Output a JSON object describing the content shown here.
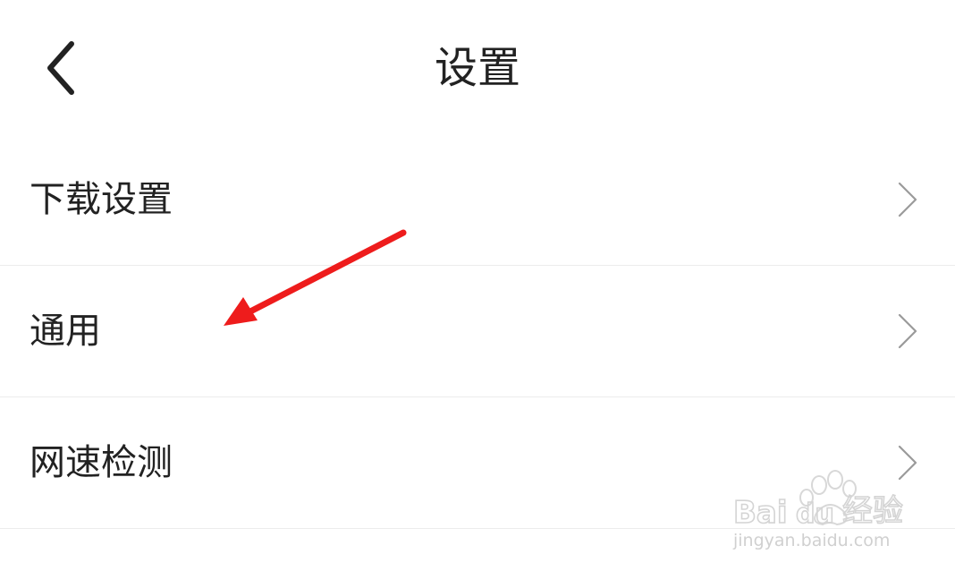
{
  "header": {
    "title": "设置",
    "back_icon": "chevron-left-icon"
  },
  "menu": {
    "items": [
      {
        "label": "下载设置",
        "icon": "chevron-right-icon"
      },
      {
        "label": "通用",
        "icon": "chevron-right-icon"
      },
      {
        "label": "网速检测",
        "icon": "chevron-right-icon"
      }
    ]
  },
  "annotation": {
    "type": "red-arrow",
    "color": "#ee1c1c"
  },
  "watermark": {
    "brand": "Baidu经验",
    "url": "jingyan.baidu.com",
    "color": "#d8d8d8"
  },
  "colors": {
    "background": "#ffffff",
    "text": "#222222",
    "divider": "#ececec",
    "chevron": "#9a9a9a"
  }
}
